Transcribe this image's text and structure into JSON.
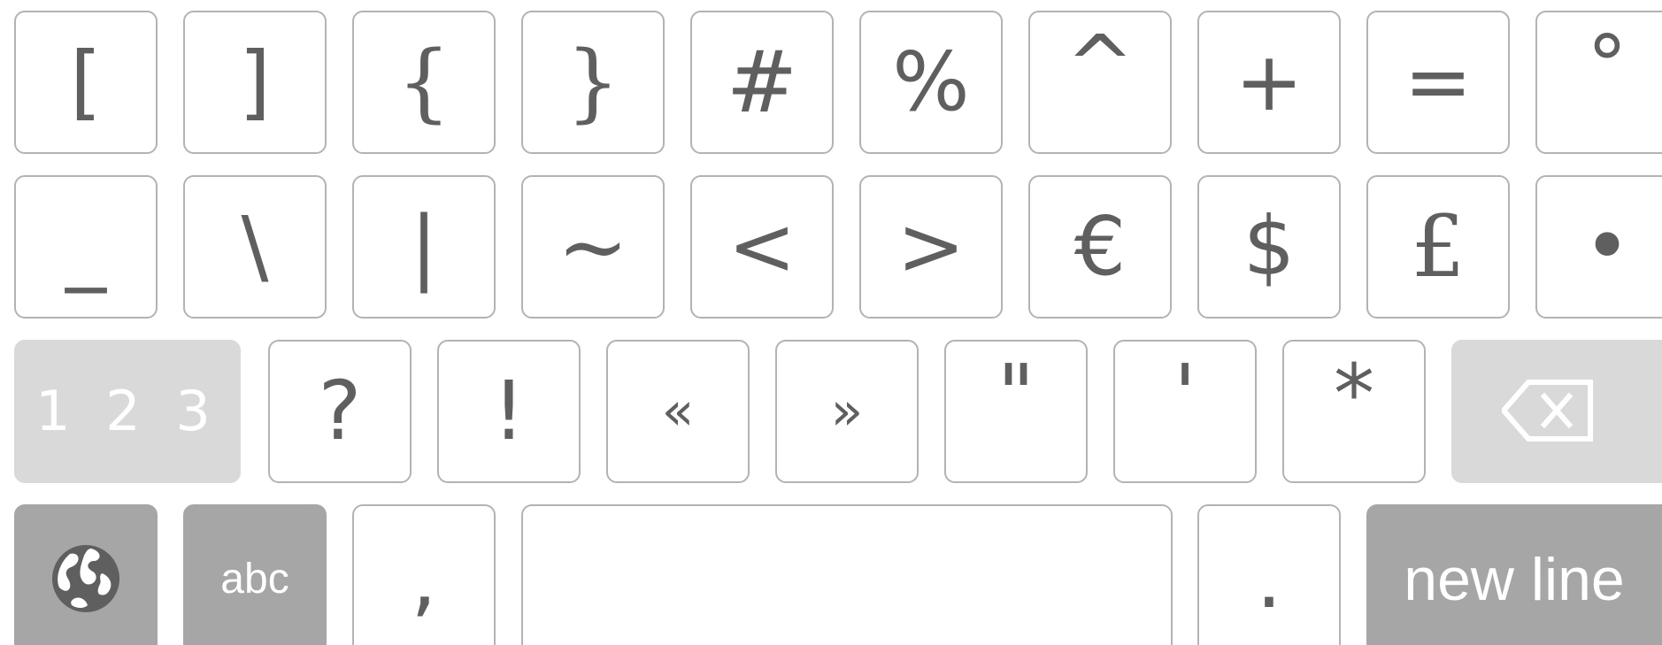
{
  "keyboard": {
    "row1": [
      "[",
      "]",
      "{",
      "}",
      "#",
      "%",
      "^",
      "+",
      "=",
      "°"
    ],
    "row2": [
      "_",
      "\\",
      "|",
      "~",
      "<",
      ">",
      "€",
      "$",
      "£",
      "•"
    ],
    "row3": [
      "?",
      "!",
      "«",
      "»",
      "\"",
      "'",
      "*"
    ],
    "numbers_key": "1 2 3",
    "abc_key": "abc",
    "comma_key": ",",
    "period_key": ".",
    "new_line_key": "new line",
    "icons": {
      "language": "globe-icon",
      "delete": "backspace-icon"
    },
    "colors": {
      "key_border": "#b3b3b3",
      "key_text": "#5f5f5f",
      "light_modifier": "#d9d9d9",
      "dark_modifier": "#a6a6a6"
    }
  }
}
